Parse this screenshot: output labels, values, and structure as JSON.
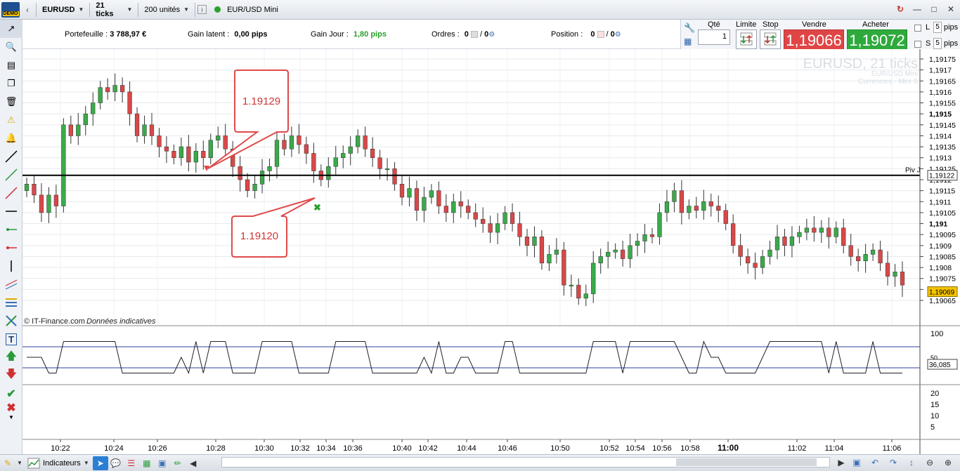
{
  "toolbar": {
    "demo_badge": "DEMO",
    "instrument": "EURUSD",
    "timeframe": "21 ticks",
    "quantity": "200 unités",
    "info_glyph": "i",
    "product": "EUR/USD Mini",
    "product_status_color": "#2ca02c"
  },
  "account": {
    "portefeuille_label": "Portefeuille :",
    "portefeuille_value": "3 788,97 €",
    "gain_latent_label": "Gain latent :",
    "gain_latent_value": "0,00 pips",
    "gain_jour_label": "Gain Jour :",
    "gain_jour_value": "1,80 pips",
    "ordres_label": "Ordres :",
    "ordres_a": "0",
    "ordres_b": "0",
    "position_label": "Position :",
    "position_a": "0",
    "position_b": "0"
  },
  "trade": {
    "qte_label": "Qté",
    "qte_value": "1",
    "limite_label": "Limite",
    "stop_label": "Stop",
    "vendre_label": "Vendre",
    "acheter_label": "Acheter",
    "sell_price": "1,19066",
    "buy_price": "1,19072",
    "l_label": "L",
    "s_label": "S",
    "l_pips": "5",
    "s_pips": "5",
    "pips_label": "pips",
    "sell_color": "#e04545",
    "buy_color": "#2eaa3c"
  },
  "chart": {
    "watermark_title": "EURUSD, 21 ticks",
    "watermark_sub1": "EUR/USD Mini",
    "watermark_sub2": "Currencies - Mini S",
    "source_credit": "© IT-Finance.com",
    "source_note": "Données indicatives",
    "pivot_label": "Piv J",
    "pivot_value": "1,19122",
    "current_price": "1,19069",
    "annotation_high": "1.19129",
    "annotation_low": "1.19120",
    "oscillator_value": "36,085"
  },
  "chart_data": {
    "type": "candlestick",
    "y_axis_labels": [
      "1,19175",
      "1,1917",
      "1,19165",
      "1,1916",
      "1,19155",
      "1,1915",
      "1,19145",
      "1,1914",
      "1,19135",
      "1,1913",
      "1,19125",
      "1,1912",
      "1,19115",
      "1,1911",
      "1,19105",
      "1,191",
      "1,19095",
      "1,1909",
      "1,19085",
      "1,1908",
      "1,19075",
      "1,1907",
      "1,19065"
    ],
    "y_axis_bold": [
      "1,1915",
      "1,191"
    ],
    "ylim": [
      1.19063,
      1.19178
    ],
    "x_labels": [
      "10:22",
      "10:24",
      "10:26",
      "10:28",
      "10:30",
      "10:32",
      "10:34",
      "10:36",
      "10:40",
      "10:42",
      "10:44",
      "10:46",
      "10:50",
      "10:52",
      "10:54",
      "10:56",
      "10:58",
      "11:00",
      "11:02",
      "11:04",
      "11:06"
    ],
    "x_label_bold": "11:00",
    "pivot": 1.19122,
    "oscillator_axis_labels": [
      "100",
      "50"
    ],
    "oscillator_levels": [
      70,
      30
    ],
    "volume_axis_labels": [
      "20",
      "15",
      "10",
      "5"
    ],
    "close_series": [
      1.19118,
      1.19113,
      1.19105,
      1.19113,
      1.19108,
      1.19145,
      1.1914,
      1.19145,
      1.1915,
      1.19155,
      1.19162,
      1.1916,
      1.19163,
      1.1916,
      1.1915,
      1.1914,
      1.19145,
      1.1914,
      1.19135,
      1.19133,
      1.1913,
      1.19135,
      1.19128,
      1.19133,
      1.1913,
      1.19138,
      1.1914,
      1.19134,
      1.19126,
      1.1912,
      1.19115,
      1.19118,
      1.19124,
      1.19126,
      1.19138,
      1.19134,
      1.1914,
      1.19136,
      1.19132,
      1.19124,
      1.1912,
      1.19126,
      1.1913,
      1.19132,
      1.19135,
      1.1914,
      1.19134,
      1.1913,
      1.19125,
      1.19125,
      1.19118,
      1.19112,
      1.19116,
      1.19106,
      1.19112,
      1.19115,
      1.19108,
      1.19105,
      1.1911,
      1.19108,
      1.19105,
      1.19102,
      1.191,
      1.19096,
      1.191,
      1.19105,
      1.191,
      1.19094,
      1.1909,
      1.19094,
      1.19082,
      1.19086,
      1.19088,
      1.19072,
      1.19072,
      1.19066,
      1.19068,
      1.19082,
      1.19085,
      1.19087,
      1.19088,
      1.19084,
      1.1909,
      1.19092,
      1.19095,
      1.19094,
      1.19105,
      1.1911,
      1.19115,
      1.19105,
      1.19108,
      1.19106,
      1.1911,
      1.19108,
      1.19106,
      1.191,
      1.1909,
      1.19085,
      1.19082,
      1.1908,
      1.19085,
      1.19088,
      1.19094,
      1.1909,
      1.19094,
      1.19096,
      1.19098,
      1.19096,
      1.19098,
      1.19094,
      1.19098,
      1.1909,
      1.19085,
      1.19083,
      1.19086,
      1.19088,
      1.19082,
      1.19076,
      1.19078,
      1.19072
    ]
  },
  "bottombar": {
    "indicateurs_label": "Indicateurs"
  }
}
